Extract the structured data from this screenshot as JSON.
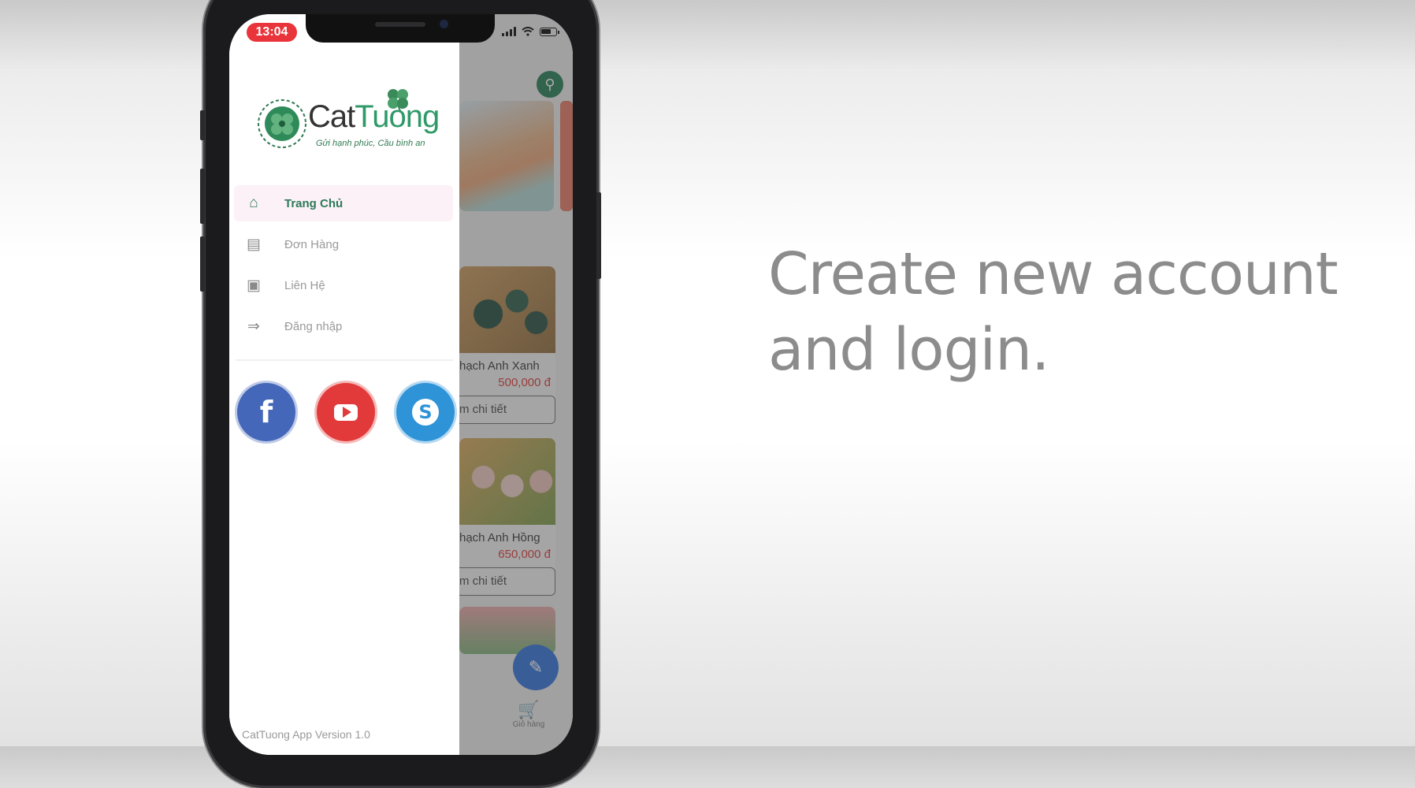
{
  "caption": {
    "line1": "Create new account",
    "line2": "and login."
  },
  "status_bar": {
    "time": "13:04"
  },
  "drawer": {
    "logo": {
      "brand_part1": "Cat",
      "brand_part2": "Tuong",
      "tagline": "Gửi hạnh phúc, Cầu bình an"
    },
    "menu": [
      {
        "label": "Trang Chủ",
        "icon": "home-icon",
        "active": true
      },
      {
        "label": "Đơn Hàng",
        "icon": "list-icon",
        "active": false
      },
      {
        "label": "Liên Hệ",
        "icon": "contact-icon",
        "active": false
      },
      {
        "label": "Đăng nhập",
        "icon": "login-icon",
        "active": false
      }
    ],
    "social": [
      {
        "name": "facebook",
        "icon": "facebook-icon",
        "color": "#4467b9",
        "glyph": "f"
      },
      {
        "name": "youtube",
        "icon": "youtube-icon",
        "color": "#e23a3a"
      },
      {
        "name": "skype",
        "icon": "skype-icon",
        "color": "#2f93d8",
        "glyph": "S"
      }
    ],
    "version": "CatTuong App Version 1.0"
  },
  "background_app": {
    "products": [
      {
        "name": "hạch Anh Xanh",
        "price": "500,000 đ",
        "button": "m chi tiết"
      },
      {
        "name": "hạch Anh Hồng",
        "price": "650,000 đ",
        "button": "m chi tiết"
      }
    ],
    "cart_label": "Giỏ hàng"
  },
  "colors": {
    "accent_green": "#2b7a57",
    "status_red": "#e8343a",
    "fab_blue": "#2f6fd7",
    "price_red": "#d33"
  }
}
